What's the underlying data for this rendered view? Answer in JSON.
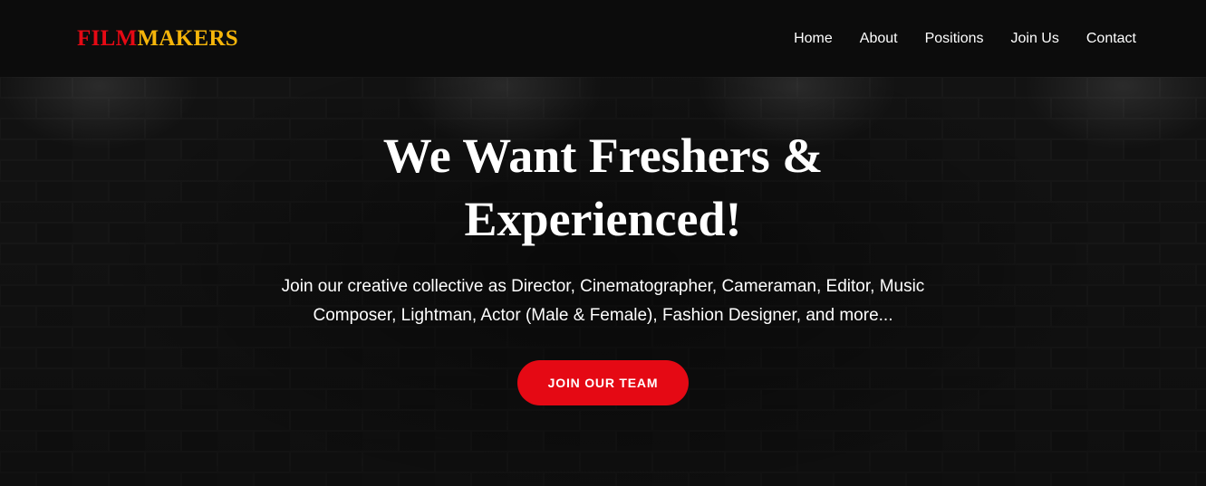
{
  "nav": {
    "logo_part1": "FILM",
    "logo_part2": "MAKERS",
    "links": [
      "Home",
      "About",
      "Positions",
      "Join Us",
      "Contact"
    ]
  },
  "hero": {
    "title": "We Want Freshers & Experienced!",
    "subtitle": "Join our creative collective as Director, Cinematographer, Cameraman, Editor, Music Composer, Lightman, Actor (Male & Female), Fashion Designer, and more...",
    "cta_label": "JOIN OUR TEAM"
  },
  "colors": {
    "brand_red": "#e50914",
    "brand_gold": "#f5b50a",
    "nav_background": "#0c0c0c",
    "text": "#ffffff"
  }
}
